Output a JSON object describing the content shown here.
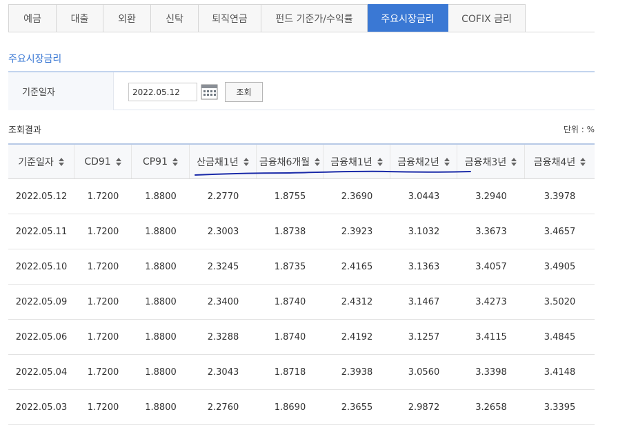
{
  "tabs": [
    {
      "label": "예금",
      "active": false
    },
    {
      "label": "대출",
      "active": false
    },
    {
      "label": "외환",
      "active": false
    },
    {
      "label": "신탁",
      "active": false
    },
    {
      "label": "퇴직연금",
      "active": false
    },
    {
      "label": "펀드 기준가/수익률",
      "active": false
    },
    {
      "label": "주요시장금리",
      "active": true
    },
    {
      "label": "COFIX 금리",
      "active": false
    }
  ],
  "section_title": "주요시장금리",
  "search": {
    "label": "기준일자",
    "date_value": "2022.05.12",
    "calendar_icon": "calendar-icon",
    "button_label": "조회"
  },
  "results": {
    "label": "조회결과",
    "unit": "단위 :  %"
  },
  "table": {
    "columns": [
      "기준일자",
      "CD91",
      "CP91",
      "산금채1년",
      "금융채6개월",
      "금융채1년",
      "금융채2년",
      "금융채3년",
      "금융채4년"
    ],
    "rows": [
      [
        "2022.05.12",
        "1.7200",
        "1.8800",
        "2.2770",
        "1.8755",
        "2.3690",
        "3.0443",
        "3.2940",
        "3.3978"
      ],
      [
        "2022.05.11",
        "1.7200",
        "1.8800",
        "2.3003",
        "1.8738",
        "2.3923",
        "3.1032",
        "3.3673",
        "3.4657"
      ],
      [
        "2022.05.10",
        "1.7200",
        "1.8800",
        "2.3245",
        "1.8735",
        "2.4165",
        "3.1363",
        "3.4057",
        "3.4905"
      ],
      [
        "2022.05.09",
        "1.7200",
        "1.8800",
        "2.3400",
        "1.8740",
        "2.4312",
        "3.1467",
        "3.4273",
        "3.5020"
      ],
      [
        "2022.05.06",
        "1.7200",
        "1.8800",
        "2.3288",
        "1.8740",
        "2.4192",
        "3.1257",
        "3.4115",
        "3.4845"
      ],
      [
        "2022.05.04",
        "1.7200",
        "1.8800",
        "2.3043",
        "1.8718",
        "2.3938",
        "3.0560",
        "3.3398",
        "3.4148"
      ],
      [
        "2022.05.03",
        "1.7200",
        "1.8800",
        "2.2760",
        "1.8690",
        "2.3655",
        "2.9872",
        "3.2658",
        "3.3395"
      ]
    ]
  },
  "colors": {
    "accent": "#3a78d4",
    "annotation_ink": "#1a2aa8"
  }
}
